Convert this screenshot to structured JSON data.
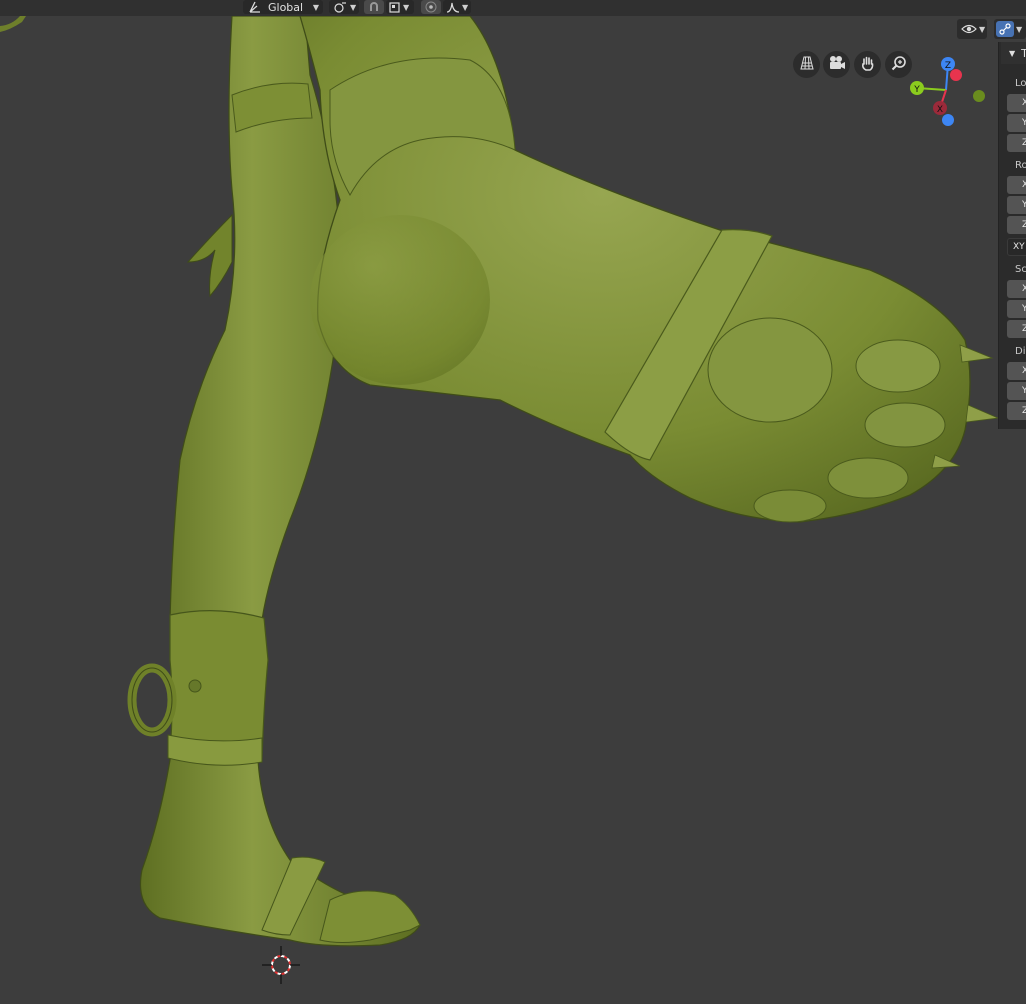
{
  "header": {
    "transform_orientation": "Global",
    "pivot_icon": "pivot-icon",
    "snap_icon": "snap-magnet-icon",
    "snap_target_icon": "snap-increment-icon",
    "proportional_icon": "proportional-edit-icon",
    "falloff_icon": "falloff-curve-icon"
  },
  "viewport": {
    "overlay_icons": [
      "eye-visibility-icon",
      "overlays-icon"
    ],
    "navigation": [
      "grid-ortho-icon",
      "camera-icon",
      "hand-pan-icon",
      "zoom-icon"
    ],
    "gizmo_axes": {
      "z": "Z",
      "y": "Y",
      "x": "X"
    }
  },
  "sidebar": {
    "tab_label": "T",
    "sections": [
      {
        "label": "Lo",
        "fields": [
          "X",
          "Y",
          "Z"
        ]
      },
      {
        "label": "Ro",
        "fields": [
          "X",
          "Y",
          "Z"
        ]
      },
      {
        "label": "",
        "select": "XY"
      },
      {
        "label": "Sc",
        "fields": [
          "X",
          "Y",
          "Z"
        ]
      },
      {
        "label": "Di",
        "fields": [
          "X",
          "Y",
          "Z"
        ]
      }
    ]
  },
  "colors": {
    "background": "#3d3d3d",
    "model_green": "#7d8f35",
    "axis_x": "#e8344e",
    "axis_y": "#8bcc1e",
    "axis_z": "#3d86f4"
  }
}
